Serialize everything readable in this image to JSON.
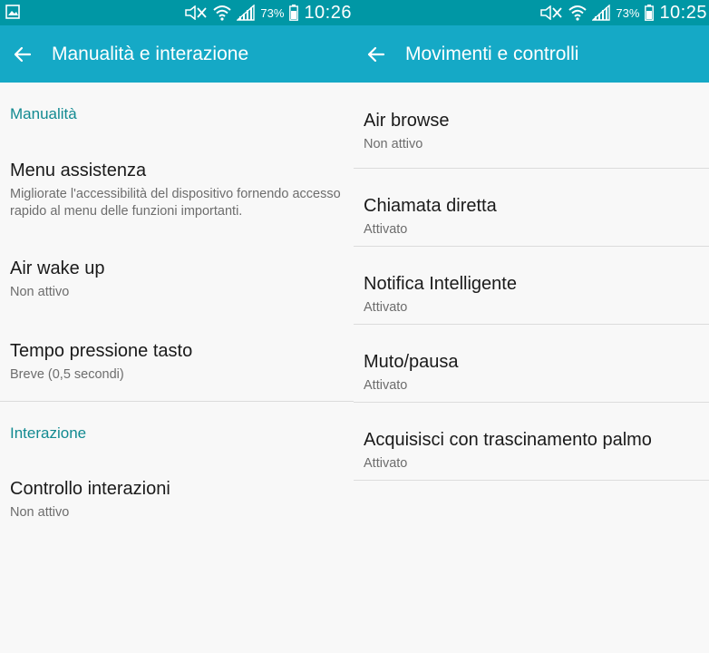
{
  "left": {
    "status": {
      "battery": "73%",
      "time": "10:26"
    },
    "appbar": {
      "title": "Manualità e interazione"
    },
    "sections": [
      {
        "header": "Manualità",
        "items": [
          {
            "title": "Menu assistenza",
            "subtitle": "Migliorate l'accessibilità del dispositivo fornendo accesso rapido al menu delle funzioni importanti."
          },
          {
            "title": "Air wake up",
            "subtitle": "Non attivo"
          },
          {
            "title": "Tempo pressione tasto",
            "subtitle": "Breve (0,5 secondi)"
          }
        ]
      },
      {
        "header": "Interazione",
        "items": [
          {
            "title": "Controllo interazioni",
            "subtitle": "Non attivo"
          }
        ]
      }
    ]
  },
  "right": {
    "status": {
      "battery": "73%",
      "time": "10:25"
    },
    "appbar": {
      "title": "Movimenti e controlli"
    },
    "items": [
      {
        "title": "Air browse",
        "subtitle": "Non attivo"
      },
      {
        "title": "Chiamata diretta",
        "subtitle": "Attivato"
      },
      {
        "title": "Notifica Intelligente",
        "subtitle": "Attivato"
      },
      {
        "title": "Muto/pausa",
        "subtitle": "Attivato"
      },
      {
        "title": "Acquisisci con trascinamento palmo",
        "subtitle": "Attivato"
      }
    ]
  },
  "icons": {
    "gallery": "image-notification-icon",
    "mute": "mute-icon",
    "wifi": "wifi-icon",
    "signal": "signal-icon",
    "back": "back-arrow-icon"
  },
  "colors": {
    "statusbar": "#0097a5",
    "appbar": "#15a9c6",
    "section_header": "#128a91",
    "background": "#f8f8f8"
  }
}
